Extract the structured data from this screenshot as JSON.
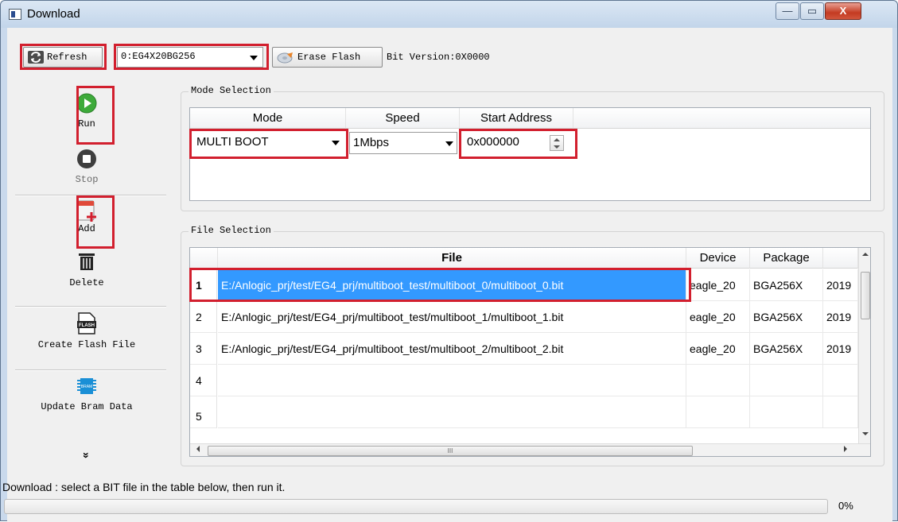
{
  "window": {
    "title": "Download",
    "minimize_glyph": "—",
    "maximize_glyph": "▭",
    "close_glyph": "X"
  },
  "toolbar": {
    "refresh_label": "Refresh",
    "device_select_value": "0:EG4X20BG256",
    "erase_flash_label": "Erase Flash",
    "bit_version_text": "Bit Version:0X0000"
  },
  "sidebar": {
    "run_label": "Run",
    "stop_label": "Stop",
    "add_label": "Add",
    "delete_label": "Delete",
    "create_flash_label": "Create Flash File",
    "flash_icon_text": "FLASH",
    "update_bram_label": "Update Bram Data",
    "bram_icon_text": "BRAM",
    "more_glyph": "»"
  },
  "mode_selection": {
    "title": "Mode Selection",
    "headers": [
      "Mode",
      "Speed",
      "Start Address"
    ],
    "mode_value": "MULTI BOOT",
    "speed_value": "1Mbps",
    "start_address_value": "0x000000"
  },
  "file_selection": {
    "title": "File Selection",
    "headers": {
      "file": "File",
      "device": "Device",
      "package": "Package",
      "extra": ""
    },
    "rows": [
      {
        "num": "1",
        "file": "E:/Anlogic_prj/test/EG4_prj/multiboot_test/multiboot_0/multiboot_0.bit",
        "device": "eagle_20",
        "package": "BGA256X",
        "extra": "2019"
      },
      {
        "num": "2",
        "file": "E:/Anlogic_prj/test/EG4_prj/multiboot_test/multiboot_1/multiboot_1.bit",
        "device": "eagle_20",
        "package": "BGA256X",
        "extra": "2019"
      },
      {
        "num": "3",
        "file": "E:/Anlogic_prj/test/EG4_prj/multiboot_test/multiboot_2/multiboot_2.bit",
        "device": "eagle_20",
        "package": "BGA256X",
        "extra": "2019"
      },
      {
        "num": "4",
        "file": "",
        "device": "",
        "package": "",
        "extra": ""
      },
      {
        "num": "5",
        "file": "",
        "device": "",
        "package": "",
        "extra": ""
      }
    ],
    "scroll_thumb_glyph": "III"
  },
  "status": {
    "message": "Download : select a BIT file in the table below, then run it.",
    "progress_percent": 0,
    "progress_text": "0%"
  },
  "colors": {
    "highlight_red": "#d21f2e",
    "selection_blue": "#3399ff",
    "run_green": "#3daa3a"
  }
}
